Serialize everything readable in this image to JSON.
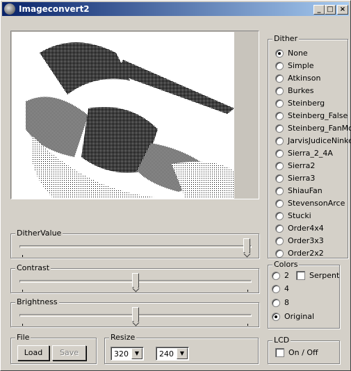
{
  "window": {
    "title": "Imageconvert2",
    "minimize": "_",
    "maximize": "□",
    "close": "×"
  },
  "preview": {
    "label": "Dithered image preview"
  },
  "dither_value": {
    "legend": "DitherValue",
    "level": 1.0
  },
  "contrast": {
    "legend": "Contrast",
    "level": 0.5
  },
  "brightness": {
    "legend": "Brightness",
    "level": 0.5
  },
  "file": {
    "legend": "File",
    "load": "Load",
    "save": "Save"
  },
  "resize": {
    "legend": "Resize",
    "width": "320",
    "height": "240"
  },
  "dither": {
    "legend": "Dither",
    "selected": "None",
    "options": [
      "None",
      "Simple",
      "Atkinson",
      "Burkes",
      "Steinberg",
      "Steinberg_False",
      "Steinberg_FanMod",
      "JarvisJudiceNinke",
      "Sierra_2_4A",
      "Sierra2",
      "Sierra3",
      "ShiauFan",
      "StevensonArce",
      "Stucki",
      "Order4x4",
      "Order3x3",
      "Order2x2"
    ]
  },
  "colors": {
    "legend": "Colors",
    "options": [
      "2",
      "4",
      "8",
      "Original"
    ],
    "selected": "Original",
    "serpent": "Serpent"
  },
  "lcd": {
    "legend": "LCD",
    "toggle": "On / Off"
  }
}
